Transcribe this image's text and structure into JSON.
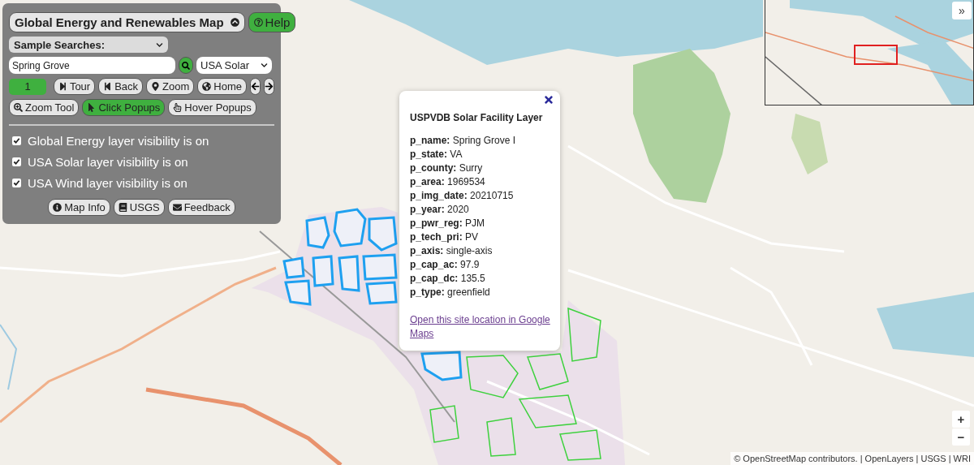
{
  "panel": {
    "title": "Global Energy and Renewables Map",
    "help": "Help",
    "sample_searches": "Sample Searches:",
    "search": {
      "value": "Spring Grove"
    },
    "layer_select": "USA Solar",
    "tour_counter": "1",
    "nav_buttons": [
      {
        "kind": "tour",
        "label": "Tour"
      },
      {
        "kind": "back",
        "label": "Back"
      },
      {
        "kind": "zoom",
        "label": "Zoom"
      },
      {
        "kind": "home",
        "label": "Home"
      }
    ],
    "tool_buttons": [
      {
        "kind": "zoom-tool",
        "label": "Zoom Tool",
        "selected": false
      },
      {
        "kind": "click",
        "label": "Click Popups",
        "selected": true
      },
      {
        "kind": "hover",
        "label": "Hover Popups",
        "selected": false
      }
    ],
    "layers": [
      {
        "label": "Global Energy layer visibility is on",
        "checked": true
      },
      {
        "label": "USA Solar layer visibility is on",
        "checked": true
      },
      {
        "label": "USA Wind layer visibility is on",
        "checked": true
      }
    ],
    "footer_buttons": [
      {
        "kind": "info",
        "label": "Map Info"
      },
      {
        "kind": "book",
        "label": "USGS"
      },
      {
        "kind": "mail",
        "label": "Feedback"
      }
    ]
  },
  "popup": {
    "title": "USPVDB Solar Facility Layer",
    "fields": [
      {
        "key": "p_name:",
        "value": "Spring Grove I"
      },
      {
        "key": "p_state:",
        "value": "VA"
      },
      {
        "key": "p_county:",
        "value": "Surry"
      },
      {
        "key": "p_area:",
        "value": "1969534"
      },
      {
        "key": "p_img_date:",
        "value": "20210715"
      },
      {
        "key": "p_year:",
        "value": "2020"
      },
      {
        "key": "p_pwr_reg:",
        "value": "PJM"
      },
      {
        "key": "p_tech_pri:",
        "value": "PV"
      },
      {
        "key": "p_axis:",
        "value": "single-axis"
      },
      {
        "key": "p_cap_ac:",
        "value": "97.9"
      },
      {
        "key": "p_cap_dc:",
        "value": "135.5"
      },
      {
        "key": "p_type:",
        "value": "greenfield"
      }
    ],
    "link": "Open this site location in Google Maps"
  },
  "overview": {
    "toggle": "»"
  },
  "zoom_controls": [
    "+",
    "−"
  ],
  "attribution": "© OpenStreetMap contributors. | OpenLayers | USGS | WRI"
}
